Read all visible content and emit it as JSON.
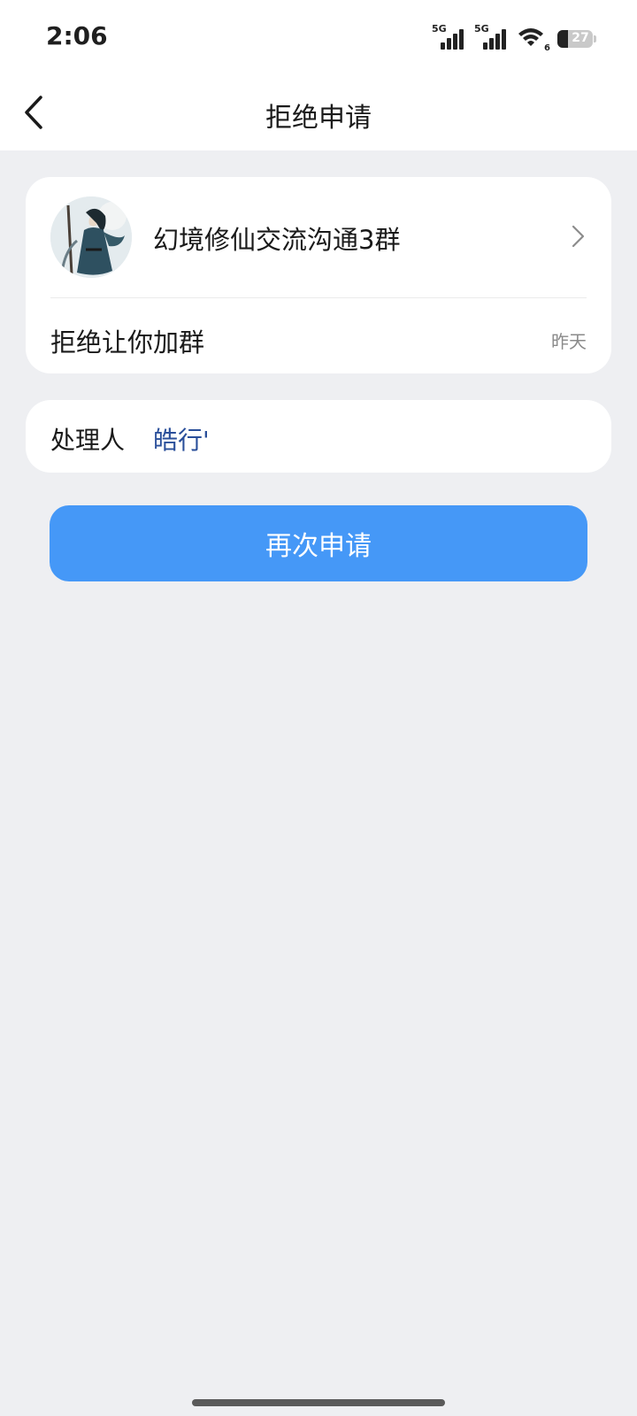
{
  "status_bar": {
    "time": "2:06",
    "signal1_label": "5G",
    "signal2_label": "5G",
    "wifi_label": "6",
    "battery": "27"
  },
  "nav": {
    "title": "拒绝申请",
    "back_icon": "chevron-left-icon"
  },
  "group": {
    "name": "幻境修仙交流沟通3群",
    "reason": "拒绝让你加群",
    "time": "昨天"
  },
  "handler": {
    "label": "处理人",
    "name": "皓行'"
  },
  "actions": {
    "reapply_label": "再次申请"
  },
  "colors": {
    "accent": "#4598f7",
    "link": "#2a4f9a",
    "background": "#eeeff2"
  }
}
